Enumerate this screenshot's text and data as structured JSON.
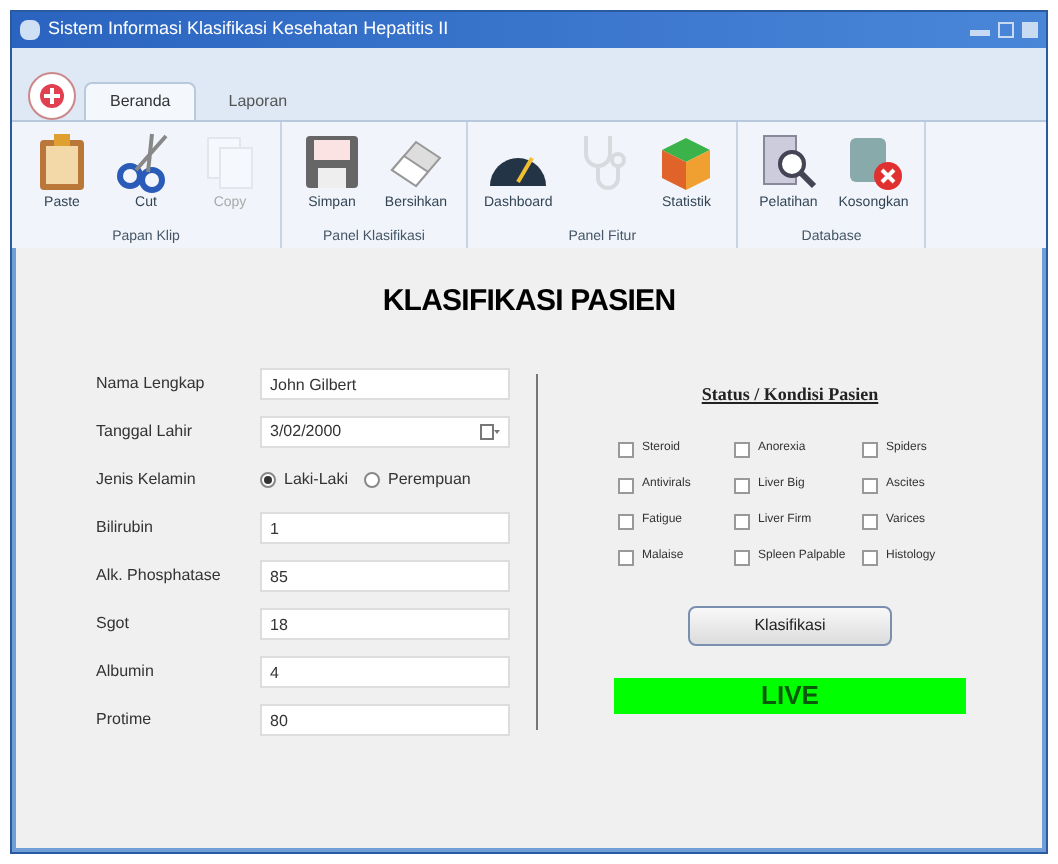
{
  "window": {
    "title": "Sistem Informasi Klasifikasi Kesehatan Hepatitis II"
  },
  "tabs": [
    {
      "label": "Beranda",
      "selected": true
    },
    {
      "label": "Laporan",
      "selected": false
    }
  ],
  "ribbon_groups": [
    {
      "label": "Papan Klip",
      "buttons": [
        {
          "label": "Paste",
          "kind": "paste",
          "disabled": false
        },
        {
          "label": "Cut",
          "kind": "cut",
          "disabled": false
        },
        {
          "label": "Copy",
          "kind": "copy",
          "disabled": true
        }
      ]
    },
    {
      "label": "Panel Klasifikasi",
      "buttons": [
        {
          "label": "Simpan",
          "kind": "save",
          "disabled": false
        },
        {
          "label": "Bersihkan",
          "kind": "eraser",
          "disabled": false
        }
      ]
    },
    {
      "label": "Panel Fitur",
      "buttons": [
        {
          "label": "Dashboard",
          "kind": "gauge",
          "disabled": false
        },
        {
          "kind": "stethoscope",
          "disabled": true
        },
        {
          "label": "Statistik",
          "kind": "chart",
          "disabled": false
        }
      ]
    },
    {
      "label": "Database",
      "buttons": [
        {
          "label": "Pelatihan",
          "kind": "search",
          "disabled": false
        },
        {
          "label": "Kosongkan",
          "kind": "dbdelete",
          "disabled": false
        }
      ]
    }
  ],
  "heading": "KLASIFIKASI PASIEN",
  "form": [
    {
      "kind": "text",
      "label": "Nama Lengkap",
      "value": "John Gilbert"
    },
    {
      "kind": "date",
      "label": "Tanggal Lahir",
      "value": "3/02/2000"
    },
    {
      "kind": "radio",
      "label": "Jenis Kelamin",
      "options": [
        {
          "label": "Laki-Laki",
          "selected": true
        },
        {
          "label": "Perempuan",
          "selected": false
        }
      ]
    },
    {
      "kind": "text",
      "label": "Bilirubin",
      "value": "1"
    },
    {
      "kind": "text",
      "label": "Alk. Phosphatase",
      "value": "85"
    },
    {
      "kind": "text",
      "label": "Sgot",
      "value": "18"
    },
    {
      "kind": "text",
      "label": "Albumin",
      "value": "4"
    },
    {
      "kind": "text",
      "label": "Protime",
      "value": "80"
    }
  ],
  "status": {
    "title": "Status / Kondisi Pasien",
    "checks": [
      {
        "label": "Steroid",
        "checked": false
      },
      {
        "label": "Anorexia",
        "checked": false
      },
      {
        "label": "Spiders",
        "checked": false
      },
      {
        "label": "Antivirals",
        "checked": false
      },
      {
        "label": "Liver Big",
        "checked": false
      },
      {
        "label": "Ascites",
        "checked": false
      },
      {
        "label": "Fatigue",
        "checked": false
      },
      {
        "label": "Liver Firm",
        "checked": false
      },
      {
        "label": "Varices",
        "checked": false
      },
      {
        "label": "Malaise",
        "checked": false
      },
      {
        "label": "Spleen Palpable",
        "checked": false
      },
      {
        "label": "Histology",
        "checked": false
      }
    ]
  },
  "classify_button": "Klasifikasi",
  "result": {
    "label": "LIVE",
    "color": "#00ff00"
  }
}
